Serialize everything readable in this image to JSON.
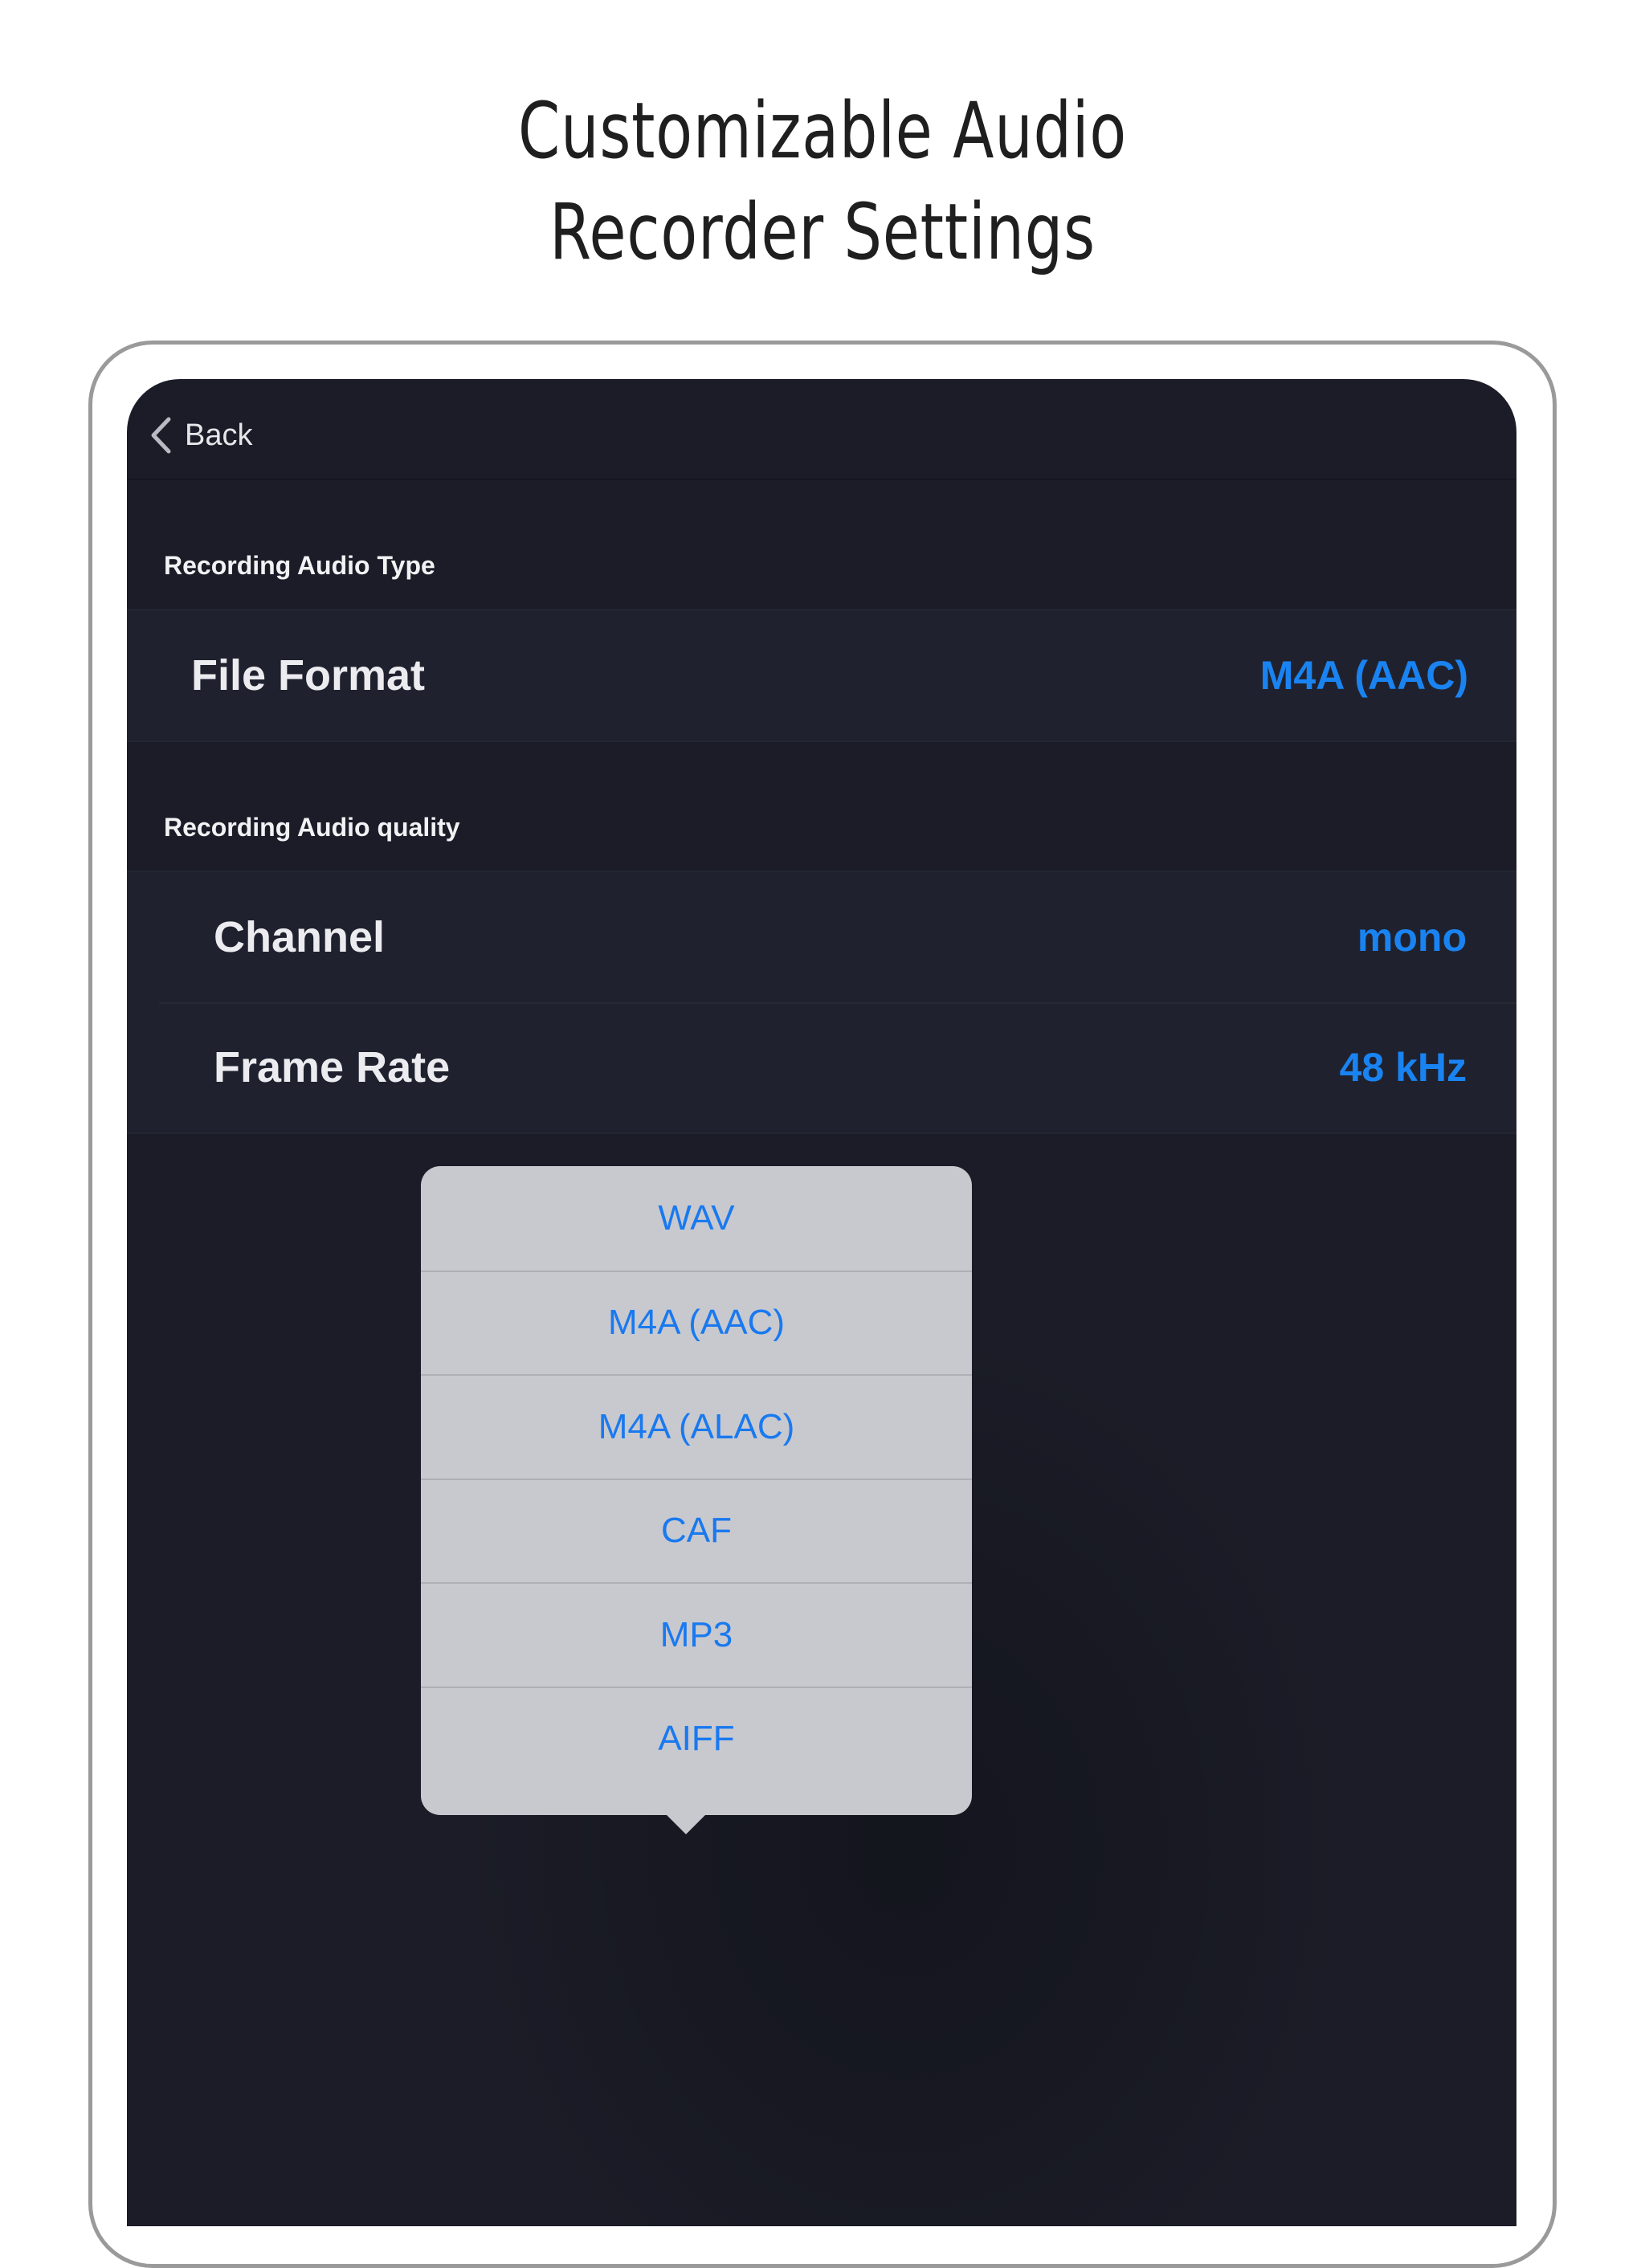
{
  "headline": {
    "line1": "Customizable Audio",
    "line2": "Recorder Settings"
  },
  "nav": {
    "back_label": "Back"
  },
  "sections": {
    "audio_type": {
      "header": "Recording Audio Type",
      "rows": [
        {
          "label": "File Format",
          "value": "M4A (AAC)"
        }
      ]
    },
    "audio_quality": {
      "header": "Recording Audio quality",
      "rows": [
        {
          "label": "Channel",
          "value": "mono"
        },
        {
          "label": "Frame Rate",
          "value": "48 kHz"
        }
      ]
    }
  },
  "format_menu": {
    "options": [
      "WAV",
      "M4A (AAC)",
      "M4A (ALAC)",
      "CAF",
      "MP3",
      "AIFF"
    ]
  },
  "colors": {
    "accent": "#1A83F2",
    "screen_background": "#1B1C27",
    "popover_background": "#C8C9CE"
  },
  "icons": {
    "back": "chevron-left-icon"
  }
}
